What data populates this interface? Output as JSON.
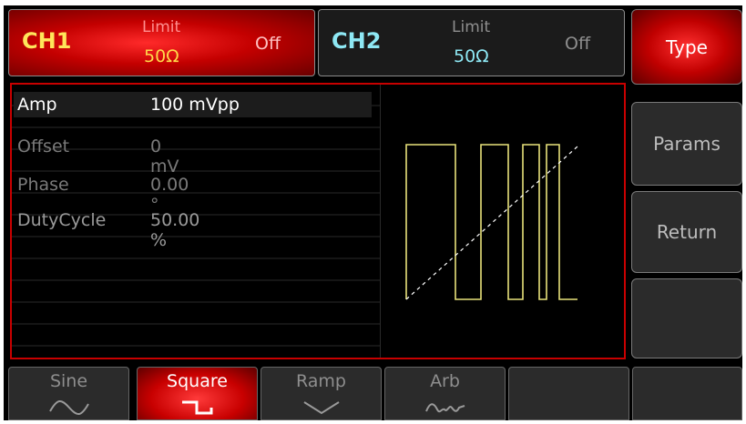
{
  "channels": [
    {
      "name": "CH1",
      "limit_label": "Limit",
      "impedance": "50Ω",
      "state": "Off"
    },
    {
      "name": "CH2",
      "limit_label": "Limit",
      "impedance": "50Ω",
      "state": "Off"
    }
  ],
  "softkeys": [
    {
      "label": "Type",
      "active": true
    },
    {
      "label": "Params",
      "active": false
    },
    {
      "label": "Return",
      "active": false
    },
    {
      "label": "",
      "active": false
    }
  ],
  "params": [
    {
      "label": "Amp",
      "value": "100 mVpp",
      "selected": true
    },
    {
      "label": "Offset",
      "value": "0 mV",
      "selected": false
    },
    {
      "label": "Phase",
      "value": "0.00 °",
      "selected": false
    },
    {
      "label": "DutyCycle",
      "value": "50.00 %",
      "selected": false
    }
  ],
  "tabs": [
    {
      "label": "Sine",
      "icon": "sine-wave-icon",
      "active": false
    },
    {
      "label": "Square",
      "icon": "square-wave-icon",
      "active": true
    },
    {
      "label": "Ramp",
      "icon": "ramp-wave-icon",
      "active": false
    },
    {
      "label": "Arb",
      "icon": "arb-wave-icon",
      "active": false
    },
    {
      "label": "",
      "icon": "",
      "active": false
    },
    {
      "label": "",
      "icon": "",
      "active": false
    }
  ],
  "colors": {
    "accent": "#c80000",
    "ch1_text": "#ffe55a",
    "ch2_text": "#8ee8f4",
    "waveform": "#e8e27a"
  }
}
